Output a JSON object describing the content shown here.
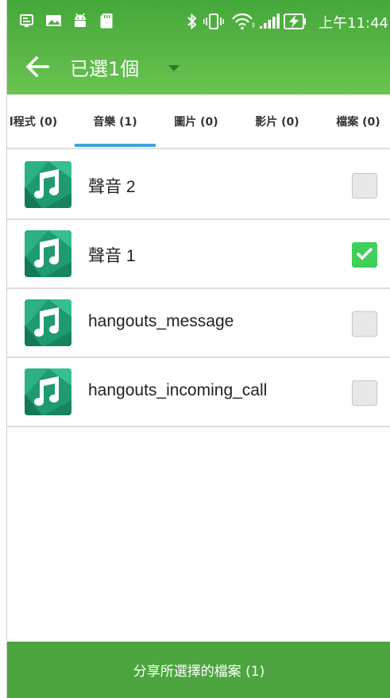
{
  "status_bar": {
    "time": "上午11:44",
    "left_icons": [
      "screenshot-icon",
      "image-icon",
      "android-icon",
      "sd-card-icon"
    ],
    "right_icons": [
      "bluetooth-icon",
      "vibrate-icon",
      "wifi-icon",
      "signal-icon",
      "battery-charging-icon"
    ]
  },
  "action_bar": {
    "title": "已選1個",
    "back_icon": "arrow-back-icon",
    "dropdown_icon": "dropdown-arrow-icon"
  },
  "tabs": [
    {
      "label": "l程式 (0)",
      "active": false
    },
    {
      "label": "音樂 (1)",
      "active": true
    },
    {
      "label": "圖片 (0)",
      "active": false
    },
    {
      "label": "影片 (0)",
      "active": false
    },
    {
      "label": "檔案 (0)",
      "active": false
    }
  ],
  "items": [
    {
      "name": "聲音 2",
      "checked": false,
      "icon": "music-note-icon"
    },
    {
      "name": "聲音 1",
      "checked": true,
      "icon": "music-note-icon"
    },
    {
      "name": "hangouts_message",
      "checked": false,
      "icon": "music-note-icon"
    },
    {
      "name": "hangouts_incoming_call",
      "checked": false,
      "icon": "music-note-icon"
    }
  ],
  "share_button": {
    "label": "分享所選擇的檔案 (1)"
  },
  "colors": {
    "primary_green": "#4ca53f",
    "tab_indicator": "#3ea6d6",
    "checkbox_checked": "#3fcf5a"
  }
}
